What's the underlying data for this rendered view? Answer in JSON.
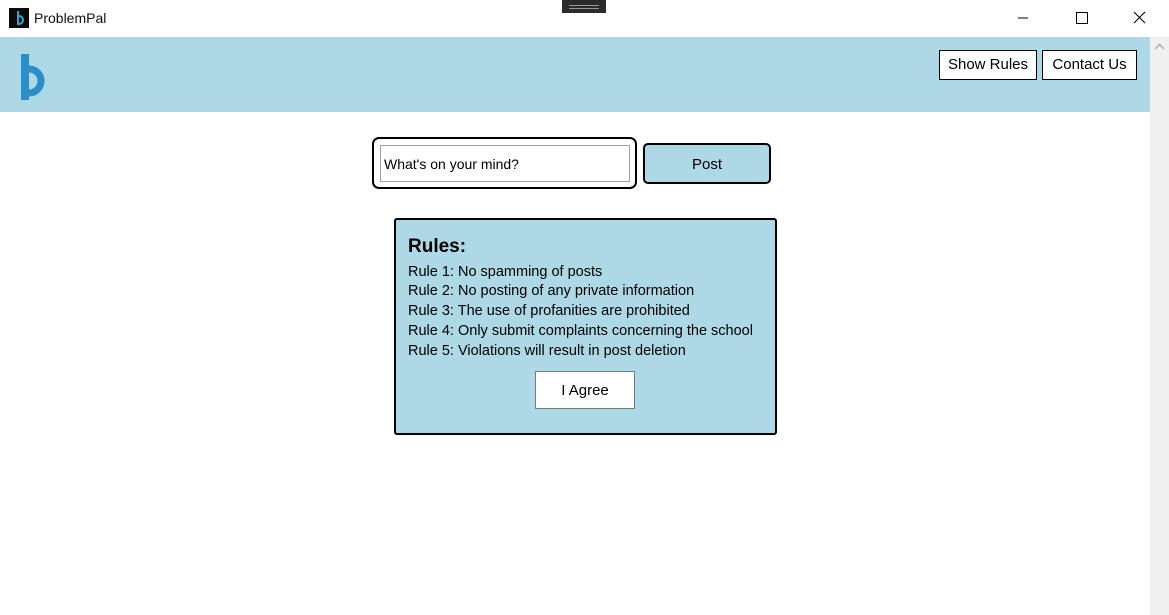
{
  "window": {
    "title": "ProblemPal",
    "controls": [
      "minimize-icon",
      "maximize-icon",
      "close-icon"
    ]
  },
  "header": {
    "background": "#add8e6",
    "logo_color": "#2a8fc9",
    "buttons": {
      "show_rules": "Show Rules",
      "contact_us": "Contact Us"
    }
  },
  "composer": {
    "placeholder": "What's on your mind?",
    "value": "",
    "post_label": "Post"
  },
  "rules_panel": {
    "title": "Rules:",
    "rules": [
      "Rule 1: No spamming of posts",
      "Rule 2: No posting of any private information",
      "Rule 3: The use of profanities are prohibited",
      "Rule 4: Only submit complaints concerning the school",
      "Rule 5: Violations will result in post deletion"
    ],
    "agree_label": "I Agree"
  }
}
